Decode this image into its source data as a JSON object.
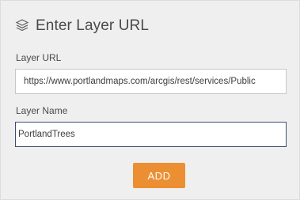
{
  "dialog": {
    "title": "Enter Layer URL",
    "icon": "layers-icon"
  },
  "fields": {
    "layer_url": {
      "label": "Layer URL",
      "value": "https://www.portlandmaps.com/arcgis/rest/services/Public"
    },
    "layer_name": {
      "label": "Layer Name",
      "value": "PortlandTrees"
    }
  },
  "actions": {
    "add_label": "ADD"
  },
  "colors": {
    "panel_background": "#efefef",
    "accent": "#ec8f33",
    "focused_border": "#3b4f70"
  }
}
